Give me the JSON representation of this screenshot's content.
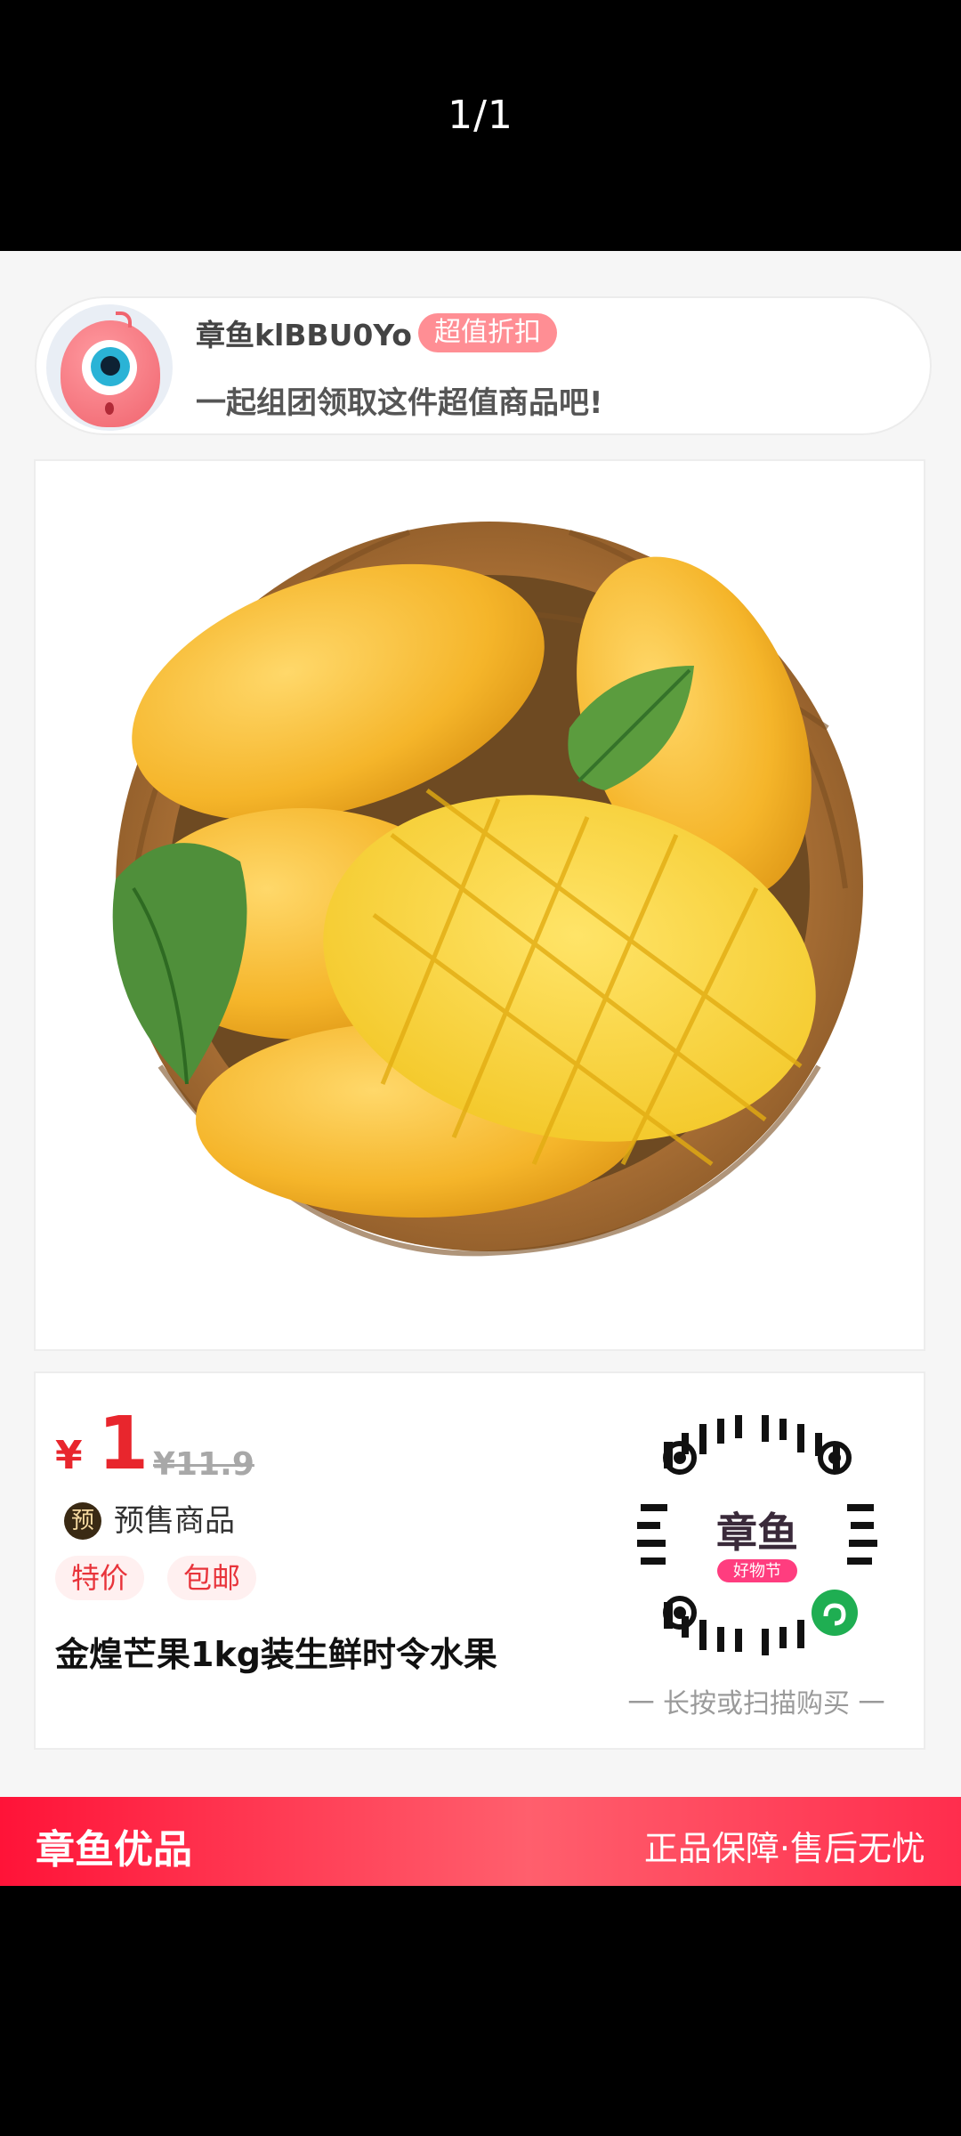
{
  "viewer": {
    "page_indicator": "1/1"
  },
  "inviter": {
    "name": "章鱼klBBU0Yo",
    "badge": "超值折扣",
    "message": "一起组团领取这件超值商品吧!"
  },
  "product": {
    "image_alt": "芒果",
    "currency": "¥",
    "price": "1",
    "original_price": "¥11.9",
    "presale_icon_text": "预",
    "presale_label": "预售商品",
    "tags": [
      "特价",
      "包邮"
    ],
    "title": "金煌芒果1kg装生鲜时令水果"
  },
  "qr": {
    "center_text": "章鱼",
    "ribbon_text": "好物节",
    "caption": "一 长按或扫描购买 一"
  },
  "brand": {
    "name": "章鱼优品",
    "slogan": "正品保障·售后无忧",
    "accent_color": "#ff1338"
  }
}
